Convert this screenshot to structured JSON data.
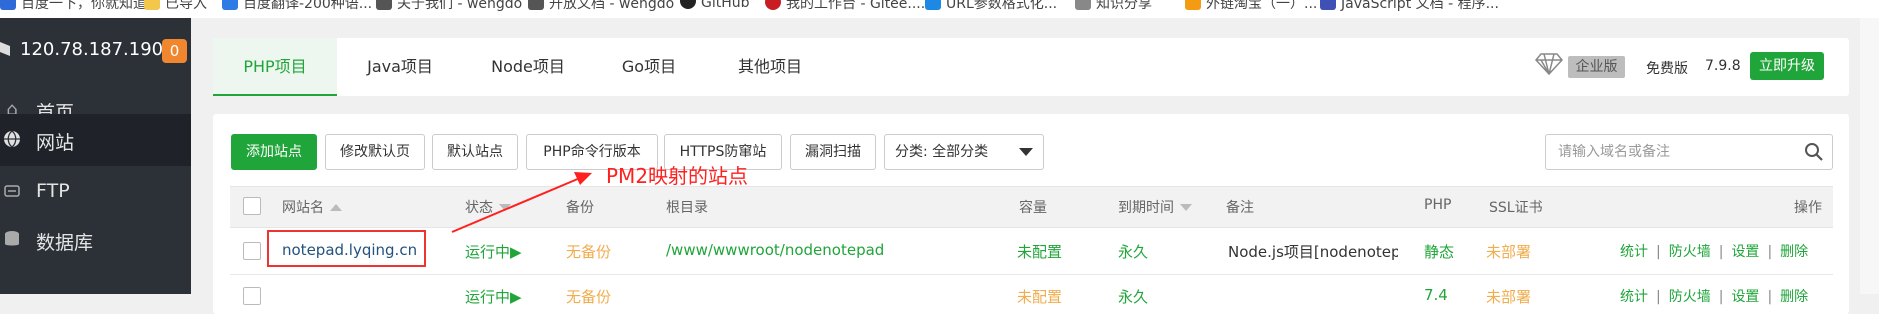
{
  "bookmarks": [
    {
      "label": "百度一下，你就知道",
      "color": "#2f6bd8"
    },
    {
      "label": "已导入",
      "color": "#f3c74b"
    },
    {
      "label": "百度翻译-200种语...",
      "color": "#2d7be5"
    },
    {
      "label": "关于我们 - wengdo",
      "color": "#555555"
    },
    {
      "label": "开放文档 - wengdo",
      "color": "#555555"
    },
    {
      "label": "GitHub",
      "color": "#222222"
    },
    {
      "label": "我的工作台 - Gitee....",
      "color": "#c71d23"
    },
    {
      "label": "URL参数格式化...",
      "color": "#1e88e5"
    },
    {
      "label": "知识分享",
      "color": "#888888"
    },
    {
      "label": "外链淘宝（一）...",
      "color": "#f39c12"
    },
    {
      "label": "JavaScript 文档 - 程序...",
      "color": "#3f51b5"
    }
  ],
  "sidebar": {
    "server_ip": "120.78.187.190",
    "badge_count": "0",
    "items": [
      {
        "label": "首页",
        "icon": "home-icon"
      },
      {
        "label": "网站",
        "icon": "globe-icon"
      },
      {
        "label": "FTP",
        "icon": "ftp-icon"
      },
      {
        "label": "数据库",
        "icon": "database-icon"
      }
    ]
  },
  "tabs": [
    "PHP项目",
    "Java项目",
    "Node项目",
    "Go项目",
    "其他项目"
  ],
  "edition": {
    "enterprise": "企业版",
    "free_label": "免费版",
    "version": "7.9.8",
    "upgrade": "立即升级"
  },
  "toolbar": {
    "add_site": "添加站点",
    "modify_default": "修改默认页",
    "default_site": "默认站点",
    "php_cli": "PHP命令行版本",
    "https_protect": "HTTPS防窜站",
    "vuln_scan": "漏洞扫描",
    "category": "分类: 全部分类",
    "search_placeholder": "请输入域名或备注"
  },
  "table": {
    "headers": [
      "网站名",
      "状态",
      "备份",
      "根目录",
      "容量",
      "到期时间",
      "备注",
      "PHP",
      "SSL证书",
      "操作"
    ],
    "rows": [
      {
        "name": "notepad.lyqing.cn",
        "status": "运行中▶",
        "backup": "无备份",
        "root": "/www/wwwroot/nodenotepad",
        "capacity": "未配置",
        "expire": "永久",
        "remark": "Node.js项目[nodenotepa",
        "php": "静态",
        "ssl": "未部署",
        "actions": [
          "统计",
          "防火墙",
          "设置",
          "删除"
        ]
      },
      {
        "name": "",
        "status": "运行中▶",
        "backup": "无备份",
        "root": "",
        "capacity": "未配置",
        "expire": "永久",
        "remark": "",
        "php": "7.4",
        "ssl": "未部署",
        "actions": [
          "统计",
          "防火墙",
          "设置",
          "删除"
        ]
      }
    ]
  },
  "annotation": "PM2映射的站点",
  "colors": {
    "accent": "#20a53a",
    "sidebar": "#2c3138",
    "annotation": "#ff2020",
    "warning": "#f0ad4e"
  }
}
